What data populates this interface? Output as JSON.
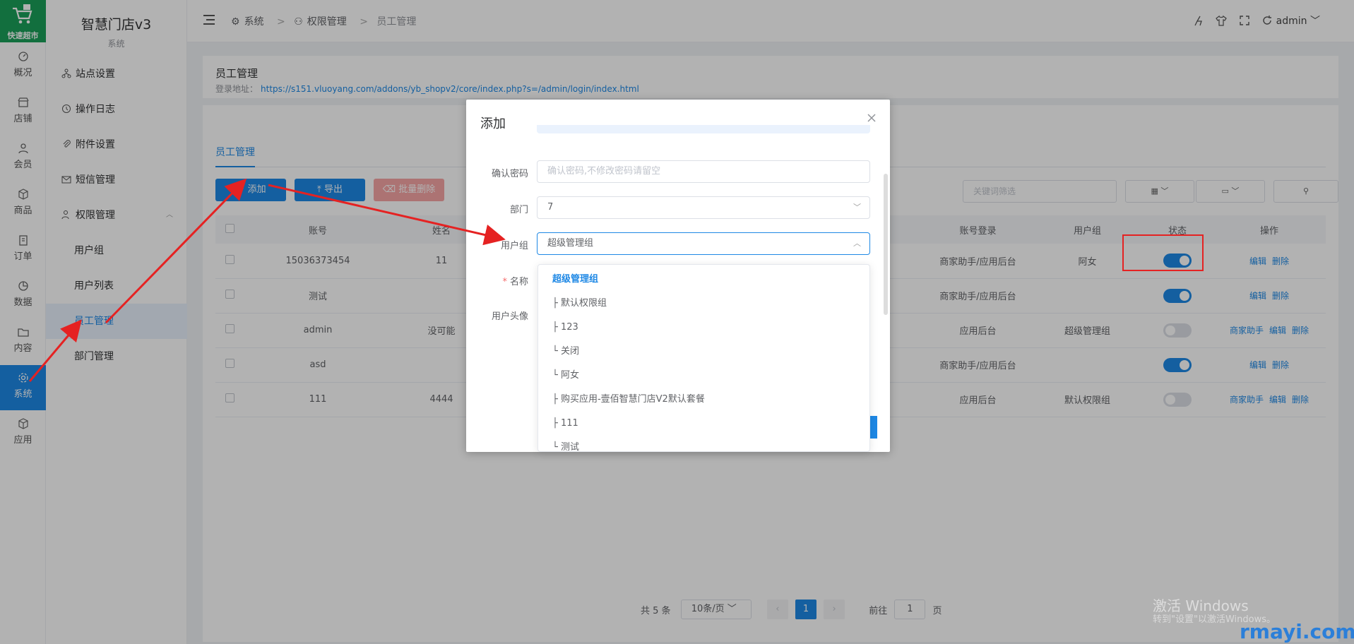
{
  "logo": {
    "text": "快速超市"
  },
  "rail": [
    {
      "key": "overview",
      "label": "概况",
      "icon": "dashboard-icon"
    },
    {
      "key": "store",
      "label": "店铺",
      "icon": "store-icon"
    },
    {
      "key": "member",
      "label": "会员",
      "icon": "user-icon"
    },
    {
      "key": "goods",
      "label": "商品",
      "icon": "box-icon"
    },
    {
      "key": "order",
      "label": "订单",
      "icon": "clipboard-icon"
    },
    {
      "key": "data",
      "label": "数据",
      "icon": "pie-icon"
    },
    {
      "key": "content",
      "label": "内容",
      "icon": "folder-icon"
    },
    {
      "key": "system",
      "label": "系统",
      "icon": "gear-icon",
      "active": true
    },
    {
      "key": "app",
      "label": "应用",
      "icon": "cube-icon"
    }
  ],
  "brand": {
    "title": "智慧门店v3",
    "subtitle": "系统"
  },
  "menu": {
    "site": "站点设置",
    "log": "操作日志",
    "attach": "附件设置",
    "sms": "短信管理",
    "perm": "权限管理",
    "sub": [
      "用户组",
      "用户列表",
      "员工管理",
      "部门管理"
    ]
  },
  "header": {
    "crumb1": "系统",
    "crumb2": "权限管理",
    "crumb3": "员工管理",
    "user": "admin"
  },
  "page": {
    "title": "员工管理",
    "login_label": "登录地址：",
    "login_url": "https://s151.vluoyang.com/addons/yb_shopv2/core/index.php?s=/admin/login/index.html",
    "tab": "员工管理",
    "btn_add": "添加",
    "btn_export": "导出",
    "btn_bulk_delete": "批量删除",
    "keyword_placeholder": "关键词筛选"
  },
  "table": {
    "headers": [
      "",
      "账号",
      "姓名",
      "账号登录",
      "用户组",
      "状态",
      "操作"
    ],
    "rows": [
      {
        "account": "15036373454",
        "name": "11",
        "login": "商家助手/应用后台",
        "group": "阿女",
        "status": true,
        "ops": [
          "编辑",
          "删除"
        ]
      },
      {
        "account": "测试",
        "name": "",
        "login": "商家助手/应用后台",
        "group": "",
        "status": true,
        "ops": [
          "编辑",
          "删除"
        ]
      },
      {
        "account": "admin",
        "name": "没可能",
        "login": "应用后台",
        "group": "超级管理组",
        "status": false,
        "ops": [
          "商家助手",
          "编辑",
          "删除"
        ]
      },
      {
        "account": "asd",
        "name": "",
        "login": "商家助手/应用后台",
        "group": "",
        "status": true,
        "ops": [
          "编辑",
          "删除"
        ]
      },
      {
        "account": "111",
        "name": "4444",
        "login": "应用后台",
        "group": "默认权限组",
        "status": false,
        "ops": [
          "商家助手",
          "编辑",
          "删除"
        ]
      }
    ]
  },
  "pager": {
    "total": "共 5 条",
    "size": "10条/页",
    "current": "1",
    "goto_prefix": "前往",
    "goto_value": "1",
    "goto_suffix": "页"
  },
  "dialog": {
    "title": "添加",
    "confirm_label": "确认密码",
    "confirm_placeholder": "确认密码,不修改密码请留空",
    "dept_label": "部门",
    "dept_value": "7",
    "group_label": "用户组",
    "group_value": "超级管理组",
    "name_label": "名称",
    "avatar_label": "用户头像"
  },
  "dropdown": {
    "options": [
      "超级管理组",
      "├ 默认权限组",
      "├ 123",
      "└ 关闭",
      "└ 阿女",
      "├ 购买应用-壹佰智慧门店V2默认套餐",
      "├ 111",
      "└ 测试"
    ],
    "selected_index": 0
  },
  "watermark": {
    "win1": "激活 Windows",
    "win2": "转到\"设置\"以激活Windows。",
    "site": "rmayi.com"
  },
  "colors": {
    "primary": "#1e88e5",
    "annotation": "#e52222",
    "logo_bg": "#1aa05a"
  }
}
